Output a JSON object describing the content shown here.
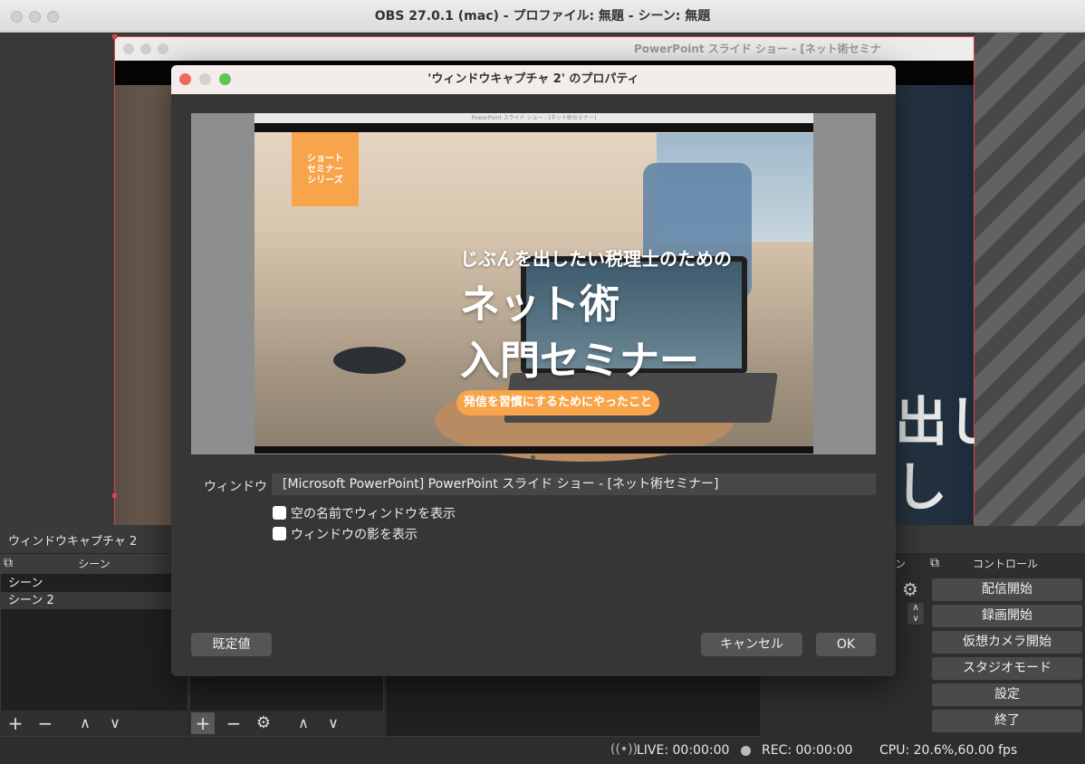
{
  "window": {
    "title": "OBS 27.0.1 (mac) - プロファイル: 無題 - シーン: 無題"
  },
  "preview": {
    "captured_window_title": "PowerPoint スライド ショー - [ネット術セミナ",
    "background_text": "出し\nし"
  },
  "dialog": {
    "title": "'ウィンドウキャプチャ 2' のプロパティ",
    "preview_title": "PowerPoint スライド ショー - [ネット術セミナー]",
    "slide": {
      "badge": "ショート\nセミナー\nシリーズ",
      "subtitle": "じぶんを出したい税理士のための",
      "title_line1": "ネット術",
      "title_line2": "入門セミナー",
      "tagline": "発信を習慣にするためにやったこと"
    },
    "window_label": "ウィンドウ",
    "window_value": "[Microsoft PowerPoint] PowerPoint スライド ショー - [ネット術セミナー]",
    "checkbox_empty_names": "空の名前でウィンドウを表示",
    "checkbox_shadow": "ウィンドウの影を表示",
    "defaults_button": "既定値",
    "cancel_button": "キャンセル",
    "ok_button": "OK"
  },
  "source_label": "ウィンドウキャプチャ 2",
  "scenes": {
    "title": "シーン",
    "items": [
      "シーン",
      "シーン 2"
    ]
  },
  "controls": {
    "title": "コントロール",
    "partial_title": "ン",
    "buttons": [
      "配信開始",
      "録画開始",
      "仮想カメラ開始",
      "スタジオモード",
      "設定",
      "終了"
    ]
  },
  "status": {
    "live": "LIVE: 00:00:00",
    "rec": "REC: 00:00:00",
    "cpu": "CPU: 20.6%,60.00 fps"
  },
  "icons": {
    "add": "+",
    "remove": "−",
    "up": "∧",
    "down": "∨",
    "gear": "⚙",
    "dock": "⧉"
  },
  "colors": {
    "accent_orange": "#f7a44a",
    "selection_border": "#e04040"
  }
}
